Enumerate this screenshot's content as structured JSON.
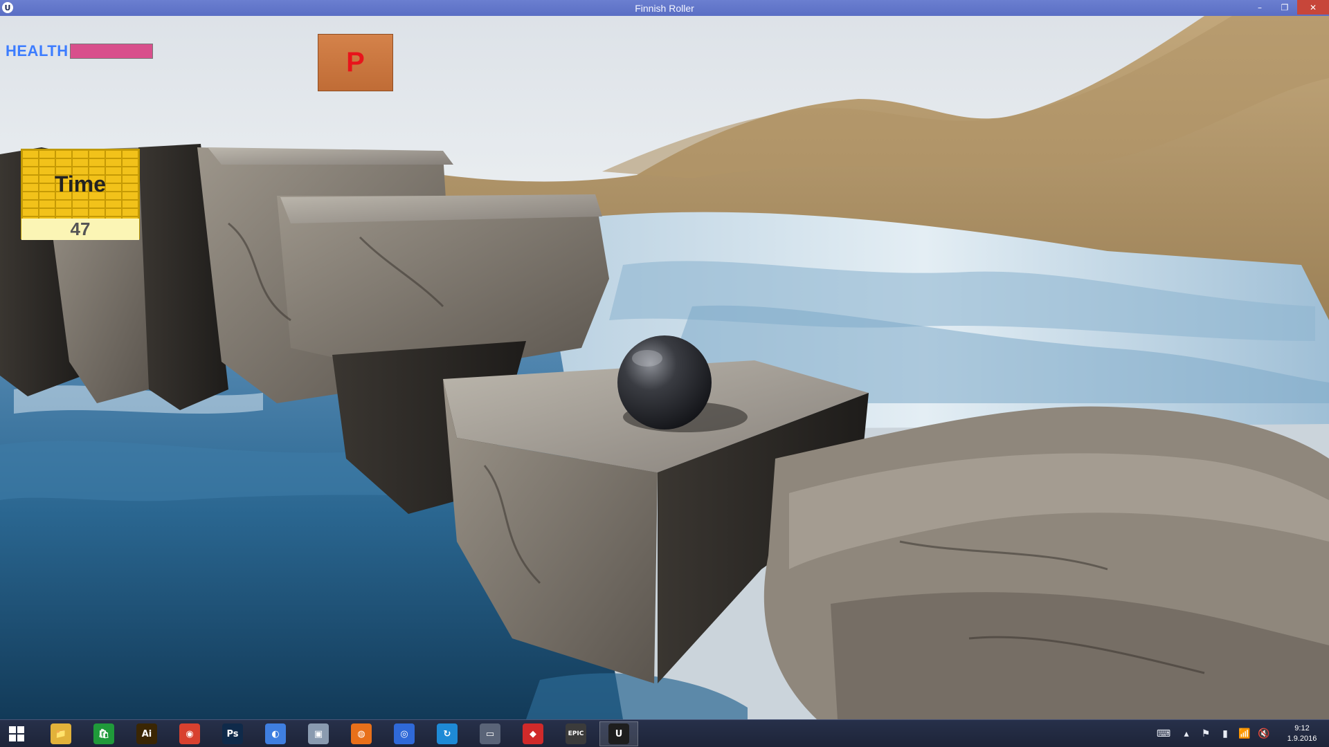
{
  "window": {
    "title": "Finnish Roller",
    "app_icon": "unreal-engine-icon",
    "controls": {
      "minimize": "–",
      "restore": "❐",
      "close": "✕"
    }
  },
  "hud": {
    "health_label": "HEALTH",
    "health_fraction": 1.0,
    "health_color": "#d84f8c",
    "pause_label": "P",
    "timer_label": "Time",
    "timer_value": "47"
  },
  "taskbar": {
    "icons": [
      {
        "name": "file-explorer-icon",
        "glyph": "📁",
        "color": "#e2b23a",
        "active": false
      },
      {
        "name": "windows-store-icon",
        "glyph": "🛍",
        "color": "#1f9a3a",
        "active": false
      },
      {
        "name": "adobe-illustrator-icon",
        "glyph": "Ai",
        "color": "#3a2604",
        "active": false
      },
      {
        "name": "chrome-icon",
        "glyph": "◉",
        "color": "#d8412f",
        "active": false
      },
      {
        "name": "photoshop-icon",
        "glyph": "Ps",
        "color": "#0f2a4a",
        "active": false
      },
      {
        "name": "chat-app-icon",
        "glyph": "◐",
        "color": "#3f7fe0",
        "active": false
      },
      {
        "name": "image-viewer-icon",
        "glyph": "▣",
        "color": "#8a9bb0",
        "active": false
      },
      {
        "name": "firefox-icon",
        "glyph": "◍",
        "color": "#e8701a",
        "active": false
      },
      {
        "name": "screen-capture-icon",
        "glyph": "◎",
        "color": "#2f69d8",
        "active": false
      },
      {
        "name": "update-app-icon",
        "glyph": "↻",
        "color": "#1e8ad6",
        "active": false
      },
      {
        "name": "laptop-icon",
        "glyph": "▭",
        "color": "#5a6478",
        "active": false
      },
      {
        "name": "game-app-icon",
        "glyph": "◆",
        "color": "#d02a2a",
        "active": false
      },
      {
        "name": "epic-games-launcher-icon",
        "glyph": "EPIC",
        "color": "#3b3b3b",
        "active": false
      },
      {
        "name": "unreal-engine-icon",
        "glyph": "U",
        "color": "#1e1e1e",
        "active": true
      }
    ],
    "tray": [
      {
        "name": "touch-keyboard-icon",
        "glyph": "⌨"
      },
      {
        "name": "show-hidden-icons-icon",
        "glyph": "▴"
      },
      {
        "name": "action-center-flag-icon",
        "glyph": "⚑"
      },
      {
        "name": "battery-icon",
        "glyph": "▮"
      },
      {
        "name": "network-signal-icon",
        "glyph": "📶"
      },
      {
        "name": "volume-muted-icon",
        "glyph": "🔇"
      }
    ],
    "clock_time": "9:12",
    "clock_date": "1.9.2016"
  }
}
